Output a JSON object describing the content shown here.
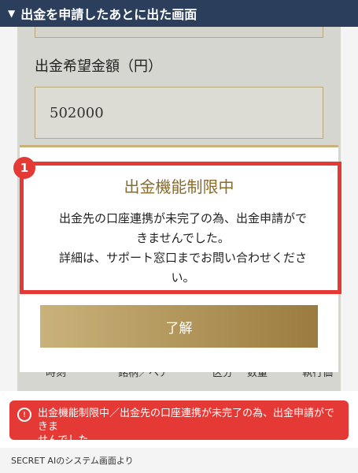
{
  "header": {
    "title": "出金を申請したあとに出た画面"
  },
  "screen": {
    "amount_label": "出金希望金額（円）",
    "amount_value": "502000",
    "table_columns": [
      "時刻",
      "銘柄／ペア",
      "区分",
      "数量",
      "執行価"
    ]
  },
  "modal": {
    "title": "出金機能制限中",
    "body_line1": "出金先の口座連携が未完了の為、出金申請がで",
    "body_line2": "きませんでした。",
    "body_line3": "詳細は、サポート窓口までお問い合わせくださ",
    "body_line4": "い。",
    "ok_label": "了解"
  },
  "annotation": {
    "badge_number": "1",
    "accent_color": "#e53935"
  },
  "error_toast": {
    "icon_label": "!",
    "line1": "出金機能制限中／出金先の口座連携が未完了の為、出金申請ができま",
    "line2": "せんでした"
  },
  "caption": "SECRET AIのシステム画面より"
}
